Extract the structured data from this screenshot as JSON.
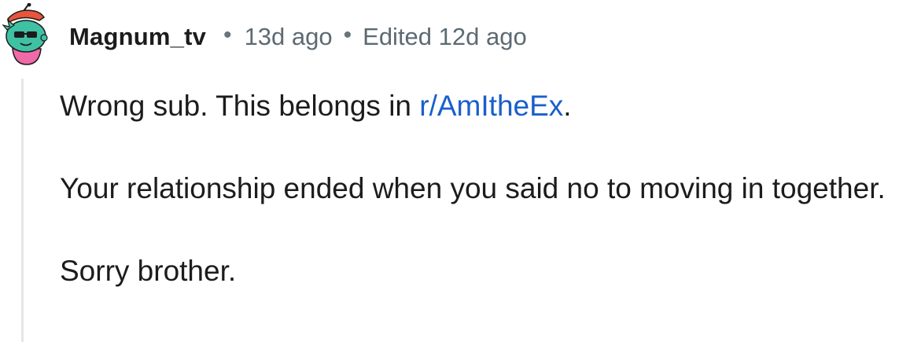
{
  "comment": {
    "author": "Magnum_tv",
    "separator": "•",
    "posted": "13d ago",
    "edited": "Edited 12d ago",
    "paragraphs": {
      "p1_before": "Wrong sub. This belongs in ",
      "p1_link": "r/AmItheEx",
      "p1_after": ".",
      "p2": "Your relationship ended when you said no to moving in together.",
      "p3": "Sorry brother."
    },
    "colors": {
      "link": "#1a5fcc",
      "text": "#1c1c1c",
      "meta": "#5c6a73",
      "thread_line": "#e3e6e8"
    },
    "avatar_icon": "snoo-avatar-icon"
  }
}
